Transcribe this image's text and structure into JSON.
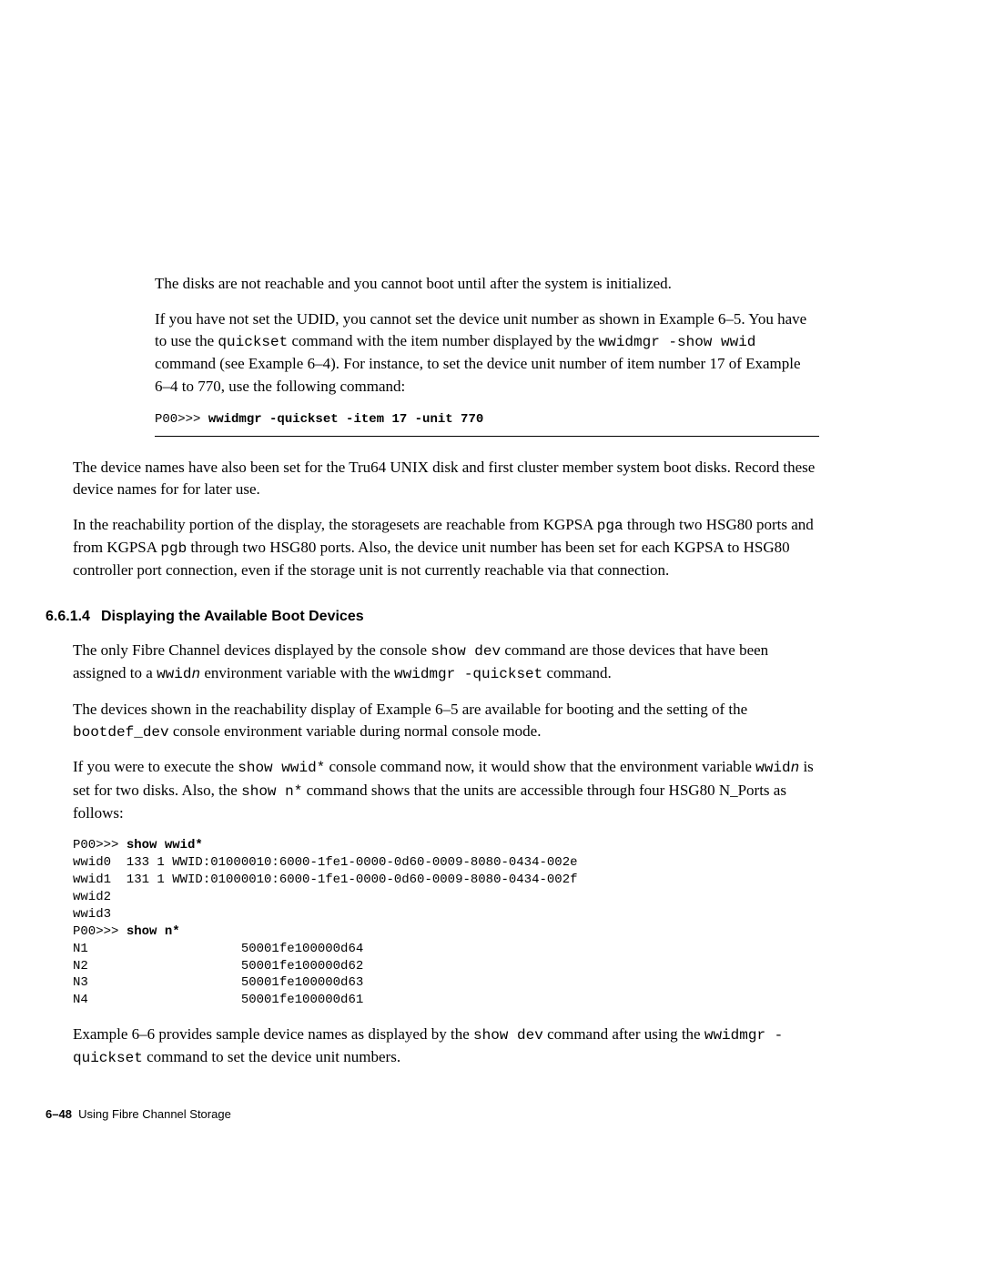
{
  "boxed": {
    "p1": "The disks are not reachable and you cannot boot until after the system is initialized.",
    "p2a": "If you have not set the UDID, you cannot set the device unit number as shown in Example 6–5. You have to use the ",
    "p2_code1": "quickset",
    "p2b": " command with the item number displayed by the ",
    "p2_code2": "wwidmgr -show wwid",
    "p2c": " command (see Example 6–4). For instance, to set the device unit number of item number 17 of Example 6–4 to 770, use the following command:",
    "cmd_prompt": "P00>>> ",
    "cmd_bold": "wwidmgr -quickset -item 17 -unit 770"
  },
  "p3": "The device names have also been set for the Tru64 UNIX disk and first cluster member system boot disks. Record these device names for for later use.",
  "p4a": "In the reachability portion of the display, the storagesets are reachable from KGPSA ",
  "p4_code1": "pga",
  "p4b": " through two HSG80 ports and from KGPSA ",
  "p4_code2": "pgb",
  "p4c": " through two HSG80 ports. Also, the device unit number has been set for each KGPSA to HSG80 controller port connection, even if the storage unit is not currently reachable via that connection.",
  "section": {
    "num": "6.6.1.4",
    "title": "Displaying the Available Boot Devices"
  },
  "p5a": "The only Fibre Channel devices displayed by the console ",
  "p5_code1": "show dev",
  "p5b": " command are those devices that have been assigned to a ",
  "p5_code2": "wwid",
  "p5_code2_ital": "n",
  "p5c": " environment variable with the ",
  "p5_code3": "wwidmgr -quickset",
  "p5d": " command.",
  "p6a": "The devices shown in the reachability display of Example 6–5 are available for booting and the setting of the ",
  "p6_code1": "bootdef_dev",
  "p6b": " console environment variable during normal console mode.",
  "p7a": "If you were to execute the ",
  "p7_code1": "show wwid*",
  "p7b": " console command now, it would show that the environment variable ",
  "p7_code2": "wwid",
  "p7_code2_ital": "n",
  "p7c": " is set for two disks. Also, the ",
  "p7_code3": "show n*",
  "p7d": " command shows that the units are accessible through four HSG80 N_Ports as follows:",
  "listing": {
    "l1_prompt": "P00>>> ",
    "l1_cmd": "show wwid*",
    "l2": "wwid0  133 1 WWID:01000010:6000-1fe1-0000-0d60-0009-8080-0434-002e",
    "l3": "wwid1  131 1 WWID:01000010:6000-1fe1-0000-0d60-0009-8080-0434-002f",
    "l4": "wwid2",
    "l5": "wwid3",
    "l6_prompt": "P00>>> ",
    "l6_cmd": "show n*",
    "l7": "N1                    50001fe100000d64",
    "l8": "N2                    50001fe100000d62",
    "l9": "N3                    50001fe100000d63",
    "l10": "N4                    50001fe100000d61"
  },
  "p8a": "Example 6–6 provides sample device names as displayed by the ",
  "p8_code1": "show dev",
  "p8b": " command after using the ",
  "p8_code2": "wwidmgr -quickset",
  "p8c": " command to set the device unit numbers.",
  "footer": {
    "page": "6–48",
    "title": "Using Fibre Channel Storage"
  }
}
